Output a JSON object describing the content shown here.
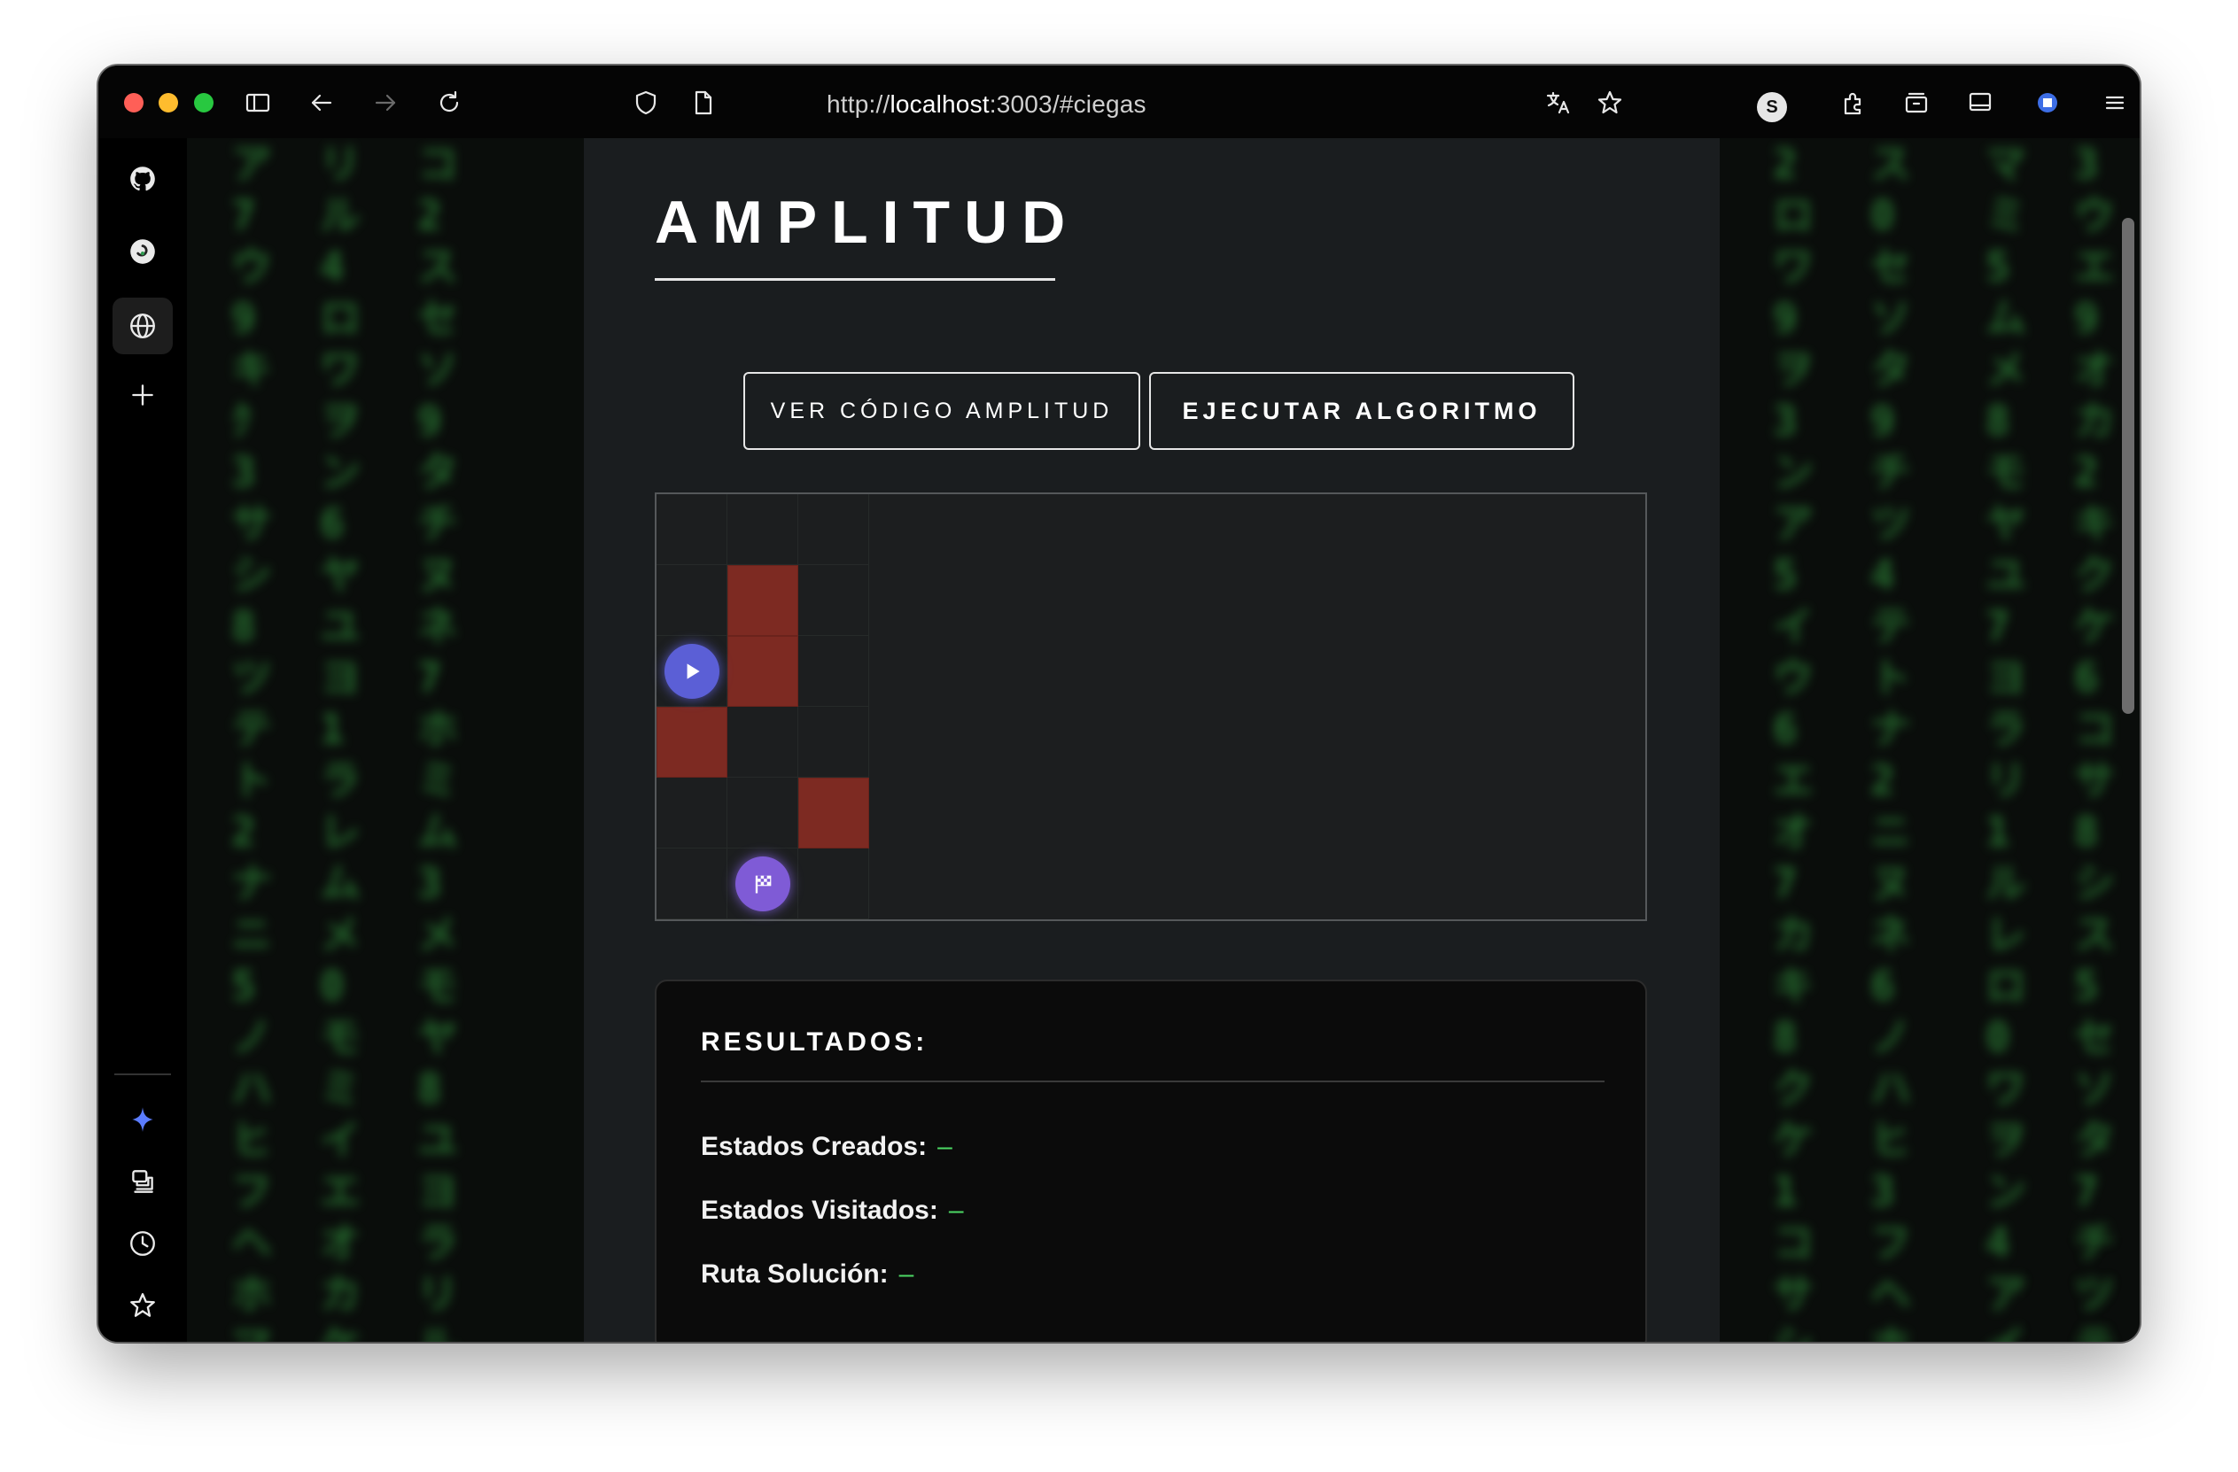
{
  "browser": {
    "url_prefix": "http://",
    "url_host": "localhost",
    "url_rest": ":3003/#ciegas",
    "profile_initial": "S"
  },
  "sidebar": {
    "items": [
      {
        "icon": "github-icon"
      },
      {
        "icon": "chatgpt-icon"
      },
      {
        "icon": "globe-icon"
      },
      {
        "icon": "plus-icon"
      },
      {
        "icon": "sparkle-icon"
      },
      {
        "icon": "extensions-icon"
      },
      {
        "icon": "history-icon"
      },
      {
        "icon": "star-icon"
      },
      {
        "icon": "settings-icon"
      }
    ]
  },
  "page": {
    "title": "AMPLITUD",
    "buttons": {
      "view_code": "VER CÓDIGO AMPLITUD",
      "run": "EJECUTAR ALGORITMO"
    },
    "grid": {
      "walls": [
        [
          1,
          1
        ],
        [
          1,
          2
        ],
        [
          0,
          3
        ],
        [
          2,
          4
        ]
      ],
      "start": [
        0,
        2
      ],
      "goal": [
        1,
        5
      ]
    },
    "results": {
      "title": "RESULTADOS:",
      "created_label": "Estados Creados:",
      "created_value": "–",
      "visited_label": "Estados Visitados:",
      "visited_value": "–",
      "path_label": "Ruta Solución:",
      "path_value": "–"
    }
  },
  "colors": {
    "wall": "#7d2a22",
    "start": "#5b5fd6",
    "goal": "#7f5bd6",
    "result_value": "#4cd964",
    "matrix": "#2f8a3a"
  }
}
